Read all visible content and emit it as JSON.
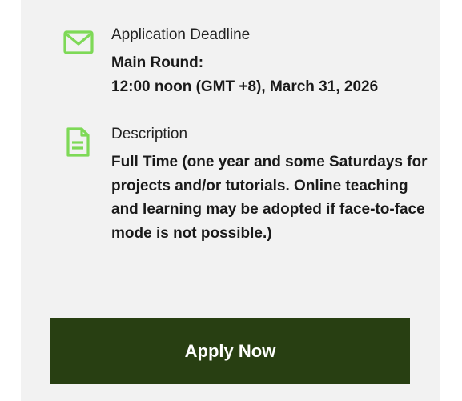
{
  "deadline": {
    "icon": "envelope-icon",
    "label": "Application Deadline",
    "line1": "Main Round:",
    "line2": "12:00 noon (GMT +8), March 31, 2026"
  },
  "description": {
    "icon": "document-icon",
    "label": "Description",
    "text": "Full Time (one year and some Saturdays for projects and/or tutorials. Online teaching and learning may be adopted if face-to-face mode is not possible.)"
  },
  "apply_button": {
    "label": "Apply Now"
  },
  "colors": {
    "icon_green": "#7ed957",
    "panel_bg": "#f2f2f2",
    "button_bg": "#283f12",
    "button_text": "#ffffff"
  }
}
